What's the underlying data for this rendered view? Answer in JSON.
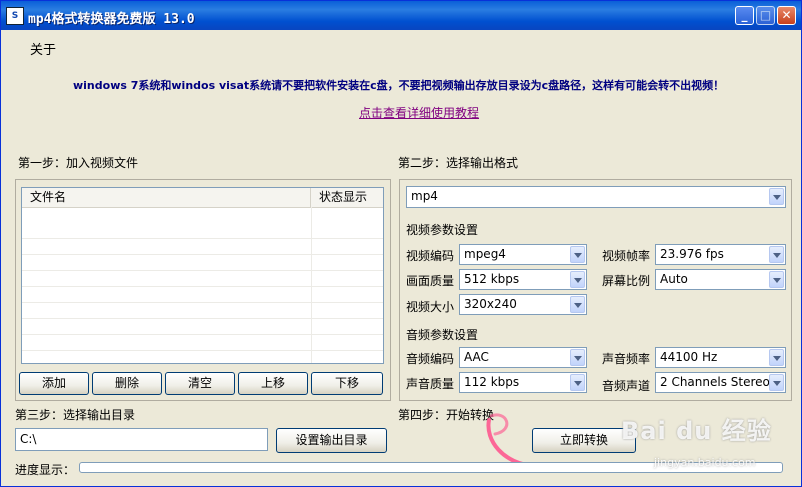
{
  "window": {
    "title": "mp4格式转换器免费版 13.0",
    "icon_text": "S"
  },
  "header": {
    "about": "关于",
    "warning": "windows 7系统和windos visat系统请不要把软件安装在c盘，不要把视频输出存放目录设为c盘路径，这样有可能会转不出视频！",
    "tutorial_link": "点击查看详细使用教程"
  },
  "step1": {
    "title": "第一步：加入视频文件",
    "columns": [
      "文件名",
      "状态显示"
    ],
    "buttons": [
      "添加",
      "删除",
      "清空",
      "上移",
      "下移"
    ]
  },
  "step2": {
    "title": "第二步：选择输出格式",
    "format": "mp4",
    "video_section": "视频参数设置",
    "video_codec_label": "视频编码",
    "video_codec": "mpeg4",
    "video_fps_label": "视频帧率",
    "video_fps": "23.976 fps",
    "quality_label": "画面质量",
    "quality": "512 kbps",
    "aspect_label": "屏幕比例",
    "aspect": "Auto",
    "size_label": "视频大小",
    "size": "320x240",
    "audio_section": "音频参数设置",
    "audio_codec_label": "音频编码",
    "audio_codec": "AAC",
    "audio_rate_label": "声音频率",
    "audio_rate": "44100 Hz",
    "audio_quality_label": "声音质量",
    "audio_quality": "112 kbps",
    "audio_channels_label": "音频声道",
    "audio_channels": "2 Channels Stereo"
  },
  "step3": {
    "title": "第三步：选择输出目录",
    "path": "C:\\",
    "set_button": "设置输出目录"
  },
  "step4": {
    "title": "第四步：开始转换",
    "start_button": "立即转换"
  },
  "progress": {
    "label": "进度显示：",
    "value": 0
  },
  "watermark": {
    "main": "Bai du 经验",
    "sub": "jingyan.baidu.com"
  },
  "colors": {
    "titlebar": "#0a5fd8",
    "window_bg": "#ece9d8",
    "warning_text": "#000080",
    "link": "#800080",
    "annotation": "#ff4f8b"
  }
}
